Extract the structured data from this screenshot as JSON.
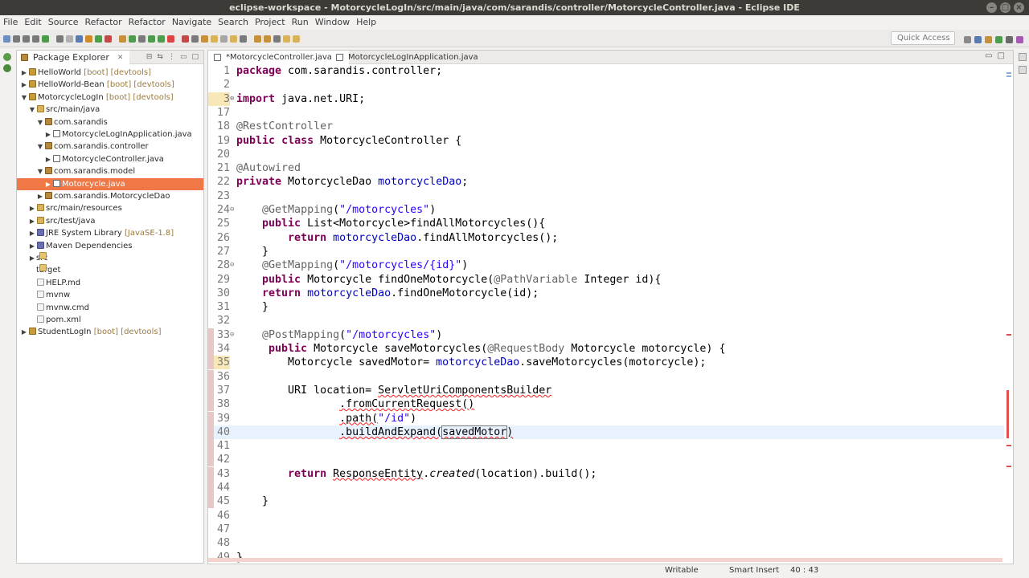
{
  "window": {
    "title": "eclipse-workspace - MotorcycleLogIn/src/main/java/com/sarandis/controller/MotorcycleController.java - Eclipse IDE"
  },
  "menu": [
    "File",
    "Edit",
    "Source",
    "Refactor",
    "Refactor",
    "Navigate",
    "Search",
    "Project",
    "Run",
    "Window",
    "Help"
  ],
  "toolbar": {
    "quick_access_placeholder": "Quick Access"
  },
  "package_explorer": {
    "tab_label": "Package Explorer",
    "items": [
      {
        "label": "HelloWorld",
        "decoration": "[boot] [devtools]",
        "icon": "project-icon",
        "expanded": false
      },
      {
        "label": "HelloWorld-Bean",
        "decoration": "[boot] [devtools]",
        "icon": "project-icon",
        "expanded": false
      },
      {
        "label": "MotorcycleLogIn",
        "decoration": "[boot] [devtools]",
        "icon": "project-icon",
        "expanded": true
      },
      {
        "label": "src/main/java",
        "decoration": "",
        "icon": "source-folder-icon",
        "expanded": true
      },
      {
        "label": "com.sarandis",
        "decoration": "",
        "icon": "package-icon",
        "expanded": true
      },
      {
        "label": "MotorcycleLogInApplication.java",
        "decoration": "",
        "icon": "java-file-icon",
        "expanded": false
      },
      {
        "label": "com.sarandis.controller",
        "decoration": "",
        "icon": "package-icon",
        "expanded": true
      },
      {
        "label": "MotorcycleController.java",
        "decoration": "",
        "icon": "java-file-icon",
        "expanded": false
      },
      {
        "label": "com.sarandis.model",
        "decoration": "",
        "icon": "package-icon",
        "expanded": true
      },
      {
        "label": "Motorcycle.java",
        "decoration": "",
        "icon": "java-file-icon",
        "expanded": false,
        "selected": true
      },
      {
        "label": "com.sarandis.MotorcycleDao",
        "decoration": "",
        "icon": "package-icon",
        "expanded": false
      },
      {
        "label": "src/main/resources",
        "decoration": "",
        "icon": "source-folder-icon",
        "expanded": false
      },
      {
        "label": "src/test/java",
        "decoration": "",
        "icon": "source-folder-icon",
        "expanded": false
      },
      {
        "label": "JRE System Library",
        "decoration": "[JavaSE-1.8]",
        "icon": "library-icon",
        "expanded": false
      },
      {
        "label": "Maven Dependencies",
        "decoration": "",
        "icon": "library-icon",
        "expanded": false
      },
      {
        "label": "src",
        "decoration": "",
        "icon": "folder-icon",
        "expanded": false
      },
      {
        "label": "target",
        "decoration": "",
        "icon": "folder-icon",
        "expanded": null
      },
      {
        "label": "HELP.md",
        "decoration": "",
        "icon": "file-icon",
        "expanded": null
      },
      {
        "label": "mvnw",
        "decoration": "",
        "icon": "file-icon",
        "expanded": null
      },
      {
        "label": "mvnw.cmd",
        "decoration": "",
        "icon": "file-icon",
        "expanded": null
      },
      {
        "label": "pom.xml",
        "decoration": "",
        "icon": "file-icon",
        "expanded": null
      },
      {
        "label": "StudentLogIn",
        "decoration": "[boot] [devtools]",
        "icon": "project-icon",
        "expanded": false
      }
    ]
  },
  "editor": {
    "tabs": [
      {
        "label": "*MotorcycleController.java",
        "active": true
      },
      {
        "label": "MotorcycleLogInApplication.java",
        "active": false
      }
    ],
    "lines": [
      {
        "n": "1",
        "text": "package com.sarandis.controller;"
      },
      {
        "n": "2",
        "text": ""
      },
      {
        "n": "3",
        "text": "import java.net.URI;"
      },
      {
        "n": "17",
        "text": ""
      },
      {
        "n": "18",
        "text": "@RestController"
      },
      {
        "n": "19",
        "text": "public class MotorcycleController {"
      },
      {
        "n": "20",
        "text": ""
      },
      {
        "n": "21",
        "text": "@Autowired"
      },
      {
        "n": "22",
        "text": "private MotorcycleDao motorcycleDao;"
      },
      {
        "n": "23",
        "text": ""
      },
      {
        "n": "24",
        "text": "    @GetMapping(\"/motorcycles\")"
      },
      {
        "n": "25",
        "text": "    public List<Motorcycle>findAllMotorcycles(){"
      },
      {
        "n": "26",
        "text": "        return motorcycleDao.findAllMotorcycles();"
      },
      {
        "n": "27",
        "text": "    }"
      },
      {
        "n": "28",
        "text": "    @GetMapping(\"/motorcycles/{id}\")"
      },
      {
        "n": "29",
        "text": "    public Motorcycle findOneMotorcycle(@PathVariable Integer id){"
      },
      {
        "n": "30",
        "text": "    return motorcycleDao.findOneMotorcycle(id);"
      },
      {
        "n": "31",
        "text": "    }"
      },
      {
        "n": "32",
        "text": ""
      },
      {
        "n": "33",
        "text": "    @PostMapping(\"/motorcycles\")"
      },
      {
        "n": "34",
        "text": "     public Motorcycle saveMotorcycles(@RequestBody Motorcycle motorcycle) {"
      },
      {
        "n": "35",
        "text": "        Motorcycle savedMotor= motorcycleDao.saveMotorcycles(motorcycle);"
      },
      {
        "n": "36",
        "text": ""
      },
      {
        "n": "37",
        "text": "        URI location= ServletUriComponentsBuilder"
      },
      {
        "n": "38",
        "text": "                .fromCurrentRequest()"
      },
      {
        "n": "39",
        "text": "                .path(\"/id\")"
      },
      {
        "n": "40",
        "text": "                .buildAndExpand(savedMotor)"
      },
      {
        "n": "41",
        "text": ""
      },
      {
        "n": "42",
        "text": ""
      },
      {
        "n": "43",
        "text": "        return ResponseEntity.created(location).build();"
      },
      {
        "n": "44",
        "text": ""
      },
      {
        "n": "45",
        "text": "    }"
      },
      {
        "n": "46",
        "text": ""
      },
      {
        "n": "47",
        "text": ""
      },
      {
        "n": "48",
        "text": ""
      },
      {
        "n": "49",
        "text": "}"
      }
    ]
  },
  "status": {
    "writable": "Writable",
    "insert_mode": "Smart Insert",
    "position": "40 : 43"
  },
  "colors": {
    "keyword": "#7f0055",
    "string": "#2a00ff",
    "field": "#0000c0",
    "annotation": "#646464",
    "selection": "#f07746",
    "titlebar": "#3c3b37"
  }
}
